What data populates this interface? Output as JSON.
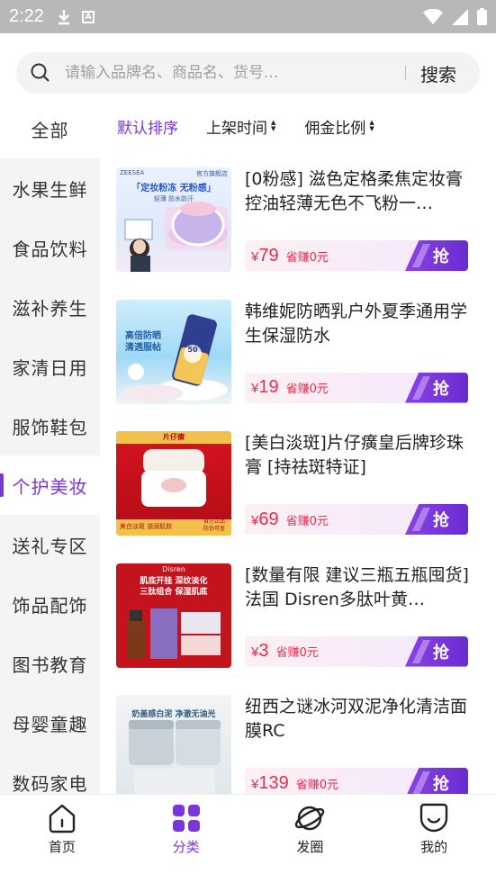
{
  "status_bar": {
    "time": "2:22",
    "icons": [
      "download-icon",
      "a-box-icon",
      "wifi-icon",
      "signal-icon",
      "battery-icon"
    ]
  },
  "search": {
    "placeholder": "请输入品牌名、商品名、货号...",
    "button_label": "搜索"
  },
  "sidebar": {
    "items": [
      {
        "label": "全部"
      },
      {
        "label": "水果生鲜"
      },
      {
        "label": "食品饮料"
      },
      {
        "label": "滋补养生"
      },
      {
        "label": "家清日用"
      },
      {
        "label": "服饰鞋包"
      },
      {
        "label": "个护美妆",
        "active": true
      },
      {
        "label": "送礼专区"
      },
      {
        "label": "饰品配饰"
      },
      {
        "label": "图书教育"
      },
      {
        "label": "母婴童趣"
      },
      {
        "label": "数码家电"
      }
    ]
  },
  "sort": {
    "default_label": "默认排序",
    "time_label": "上架时间",
    "commission_label": "佣金比例"
  },
  "products": [
    {
      "title": "[0粉感] 滋色定格柔焦定妆膏控油轻薄无色不飞粉一…",
      "currency": "¥",
      "price": "79",
      "save": "省赚0元",
      "grab": "抢",
      "thumb_text": {
        "brand": "ZEESEA",
        "tag": "官方旗舰店",
        "line1": "「定妆粉冻 无粉感」",
        "line2": "轻薄 防水防汗"
      }
    },
    {
      "title": "韩维妮防晒乳户外夏季通用学生保湿防水",
      "currency": "¥",
      "price": "19",
      "save": "省赚0元",
      "grab": "抢",
      "thumb_text": {
        "line1": "高倍防晒",
        "line2": "清透服帖",
        "badge": "50"
      }
    },
    {
      "title": "[美白淡斑]片仔癀皇后牌珍珠膏 [持祛斑特证]",
      "currency": "¥",
      "price": "69",
      "save": "省赚0元",
      "grab": "抢",
      "thumb_text": {
        "top": "片仔癀",
        "left": "美白淡斑 滋润肌肤",
        "right": "官方正品 防伪可查"
      }
    },
    {
      "title": "[数量有限 建议三瓶五瓶囤货]法国 Disren多肽叶黄…",
      "currency": "¥",
      "price": "3",
      "save": "省赚0元",
      "grab": "抢",
      "thumb_text": {
        "brand": "Disren",
        "line1": "肌底开挂 深纹淡化",
        "line2": "三肽组合 保湿肌底"
      }
    },
    {
      "title": "纽西之谜冰河双泥净化清洁面膜RC",
      "currency": "¥",
      "price": "139",
      "save": "省赚0元",
      "grab": "抢",
      "thumb_text": {
        "line1": "奶盖感白泥 净澈无油光"
      }
    }
  ],
  "bottom_nav": [
    {
      "label": "首页",
      "icon": "home-icon"
    },
    {
      "label": "分类",
      "icon": "category-icon",
      "active": true
    },
    {
      "label": "发圈",
      "icon": "planet-icon"
    },
    {
      "label": "我的",
      "icon": "smile-icon"
    }
  ],
  "colors": {
    "accent": "#7b35d9",
    "price": "#ec2a4c",
    "statusbar": "#b8b8b8"
  }
}
